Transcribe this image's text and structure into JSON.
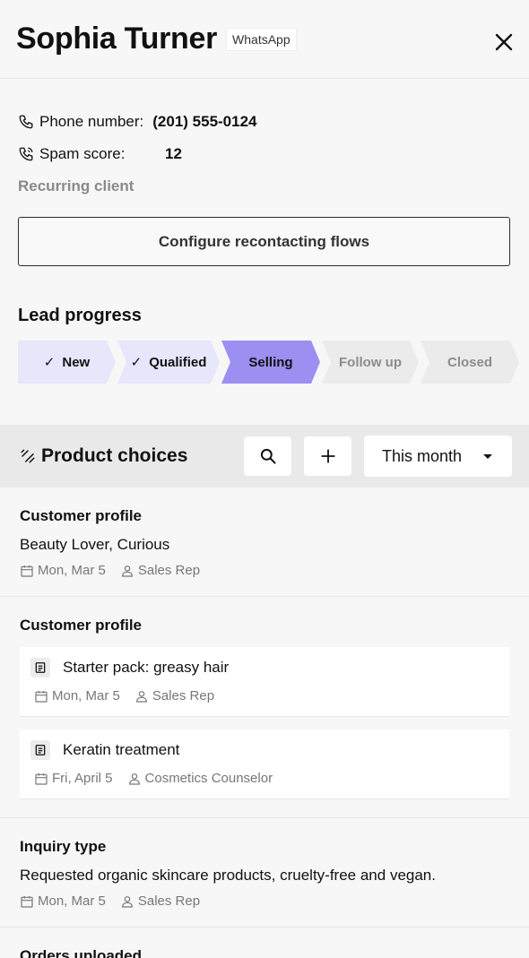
{
  "header": {
    "name": "Sophia Turner",
    "channel": "WhatsApp"
  },
  "info": {
    "phone_label": "Phone number:",
    "phone_value": "(201) 555-0124",
    "spam_label": "Spam score:",
    "spam_value": "12",
    "recurring": "Recurring client"
  },
  "config_button": "Configure recontacting flows",
  "lead_progress": {
    "title": "Lead progress",
    "steps": [
      {
        "label": "New",
        "state": "done"
      },
      {
        "label": "Qualified",
        "state": "done"
      },
      {
        "label": "Selling",
        "state": "active"
      },
      {
        "label": "Follow up",
        "state": "todo"
      },
      {
        "label": "Closed",
        "state": "todo"
      }
    ]
  },
  "product_choices": {
    "title": "Product choices",
    "period": "This month"
  },
  "sections": [
    {
      "title": "Customer profile",
      "text": "Beauty Lover, Curious",
      "date": "Mon, Mar 5",
      "author": "Sales Rep"
    },
    {
      "title": "Customer profile",
      "cards": [
        {
          "title": "Starter pack: greasy hair",
          "date": "Mon, Mar 5",
          "author": "Sales Rep"
        },
        {
          "title": "Keratin treatment",
          "date": "Fri, April 5",
          "author": "Cosmetics Counselor"
        }
      ]
    },
    {
      "title": "Inquiry type",
      "text": "Requested organic skincare products, cruelty-free and vegan.",
      "date": "Mon, Mar 5",
      "author": "Sales Rep"
    },
    {
      "title": "Orders uploaded"
    }
  ],
  "colors": {
    "accent": "#9b8ff2",
    "done_step": "#e6e7fb",
    "todo_step": "#ebebeb"
  }
}
